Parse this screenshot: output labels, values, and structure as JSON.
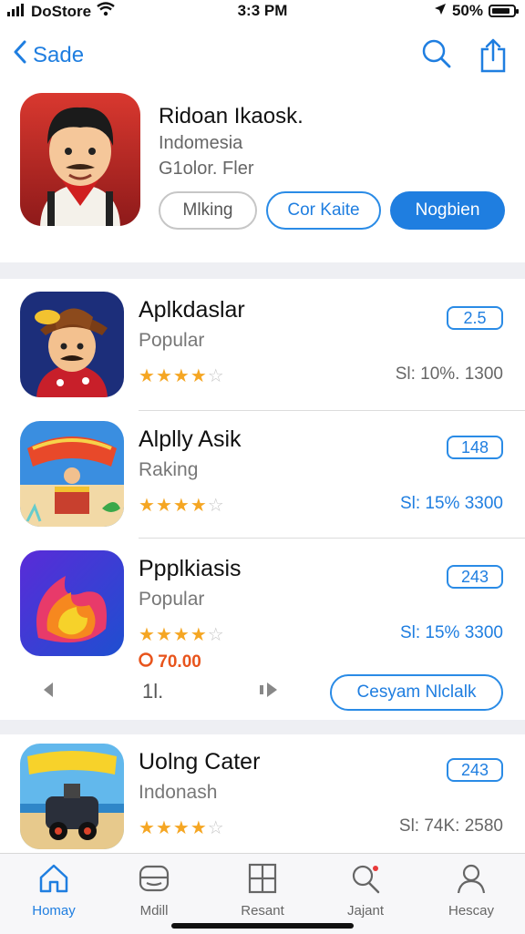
{
  "status": {
    "carrier": "DoStore",
    "time": "3:3 PM",
    "battery": "50%",
    "battery_level": 0.85
  },
  "nav": {
    "back_label": "Sade"
  },
  "hero": {
    "title": "Ridoan Ikaosk.",
    "subtitle": "Indomesia",
    "meta": "G1olor. Fler",
    "buttons": {
      "secondary": "Mlking",
      "outline": "Cor Kaite",
      "primary": "Nogbien"
    }
  },
  "apps": [
    {
      "name": "Aplkdaslar",
      "category": "Popular",
      "rating": 4,
      "badge": "2.5",
      "price": "Sl: 10%. 1300",
      "price_blue": false
    },
    {
      "name": "Alplly Asik",
      "category": "Raking",
      "rating": 3.5,
      "badge": "148",
      "price": "Sl: 15% 3300",
      "price_blue": true
    },
    {
      "name": "Ppplkiasis",
      "category": "Popular",
      "rating": 4,
      "badge": "243",
      "price": "Sl: 15% 3300",
      "price_blue": true,
      "promo": "70.00"
    },
    {
      "name": "Uolng Cater",
      "category": "Indonash",
      "rating": 3.5,
      "badge": "243",
      "price": "Sl: 74K: 2580",
      "price_blue": false
    }
  ],
  "pager": {
    "page": "1l.",
    "cta": "Cesyam Nlclalk"
  },
  "tabs": [
    {
      "label": "Homay",
      "icon": "home-icon",
      "active": true
    },
    {
      "label": "Mdill",
      "icon": "mail-box-icon",
      "active": false
    },
    {
      "label": "Resant",
      "icon": "grid-icon",
      "active": false
    },
    {
      "label": "Jajant",
      "icon": "search-icon",
      "active": false
    },
    {
      "label": "Hescay",
      "icon": "person-icon",
      "active": false
    }
  ],
  "colors": {
    "accent": "#1f7ee0",
    "star": "#f5a623",
    "promo": "#e8541c"
  }
}
